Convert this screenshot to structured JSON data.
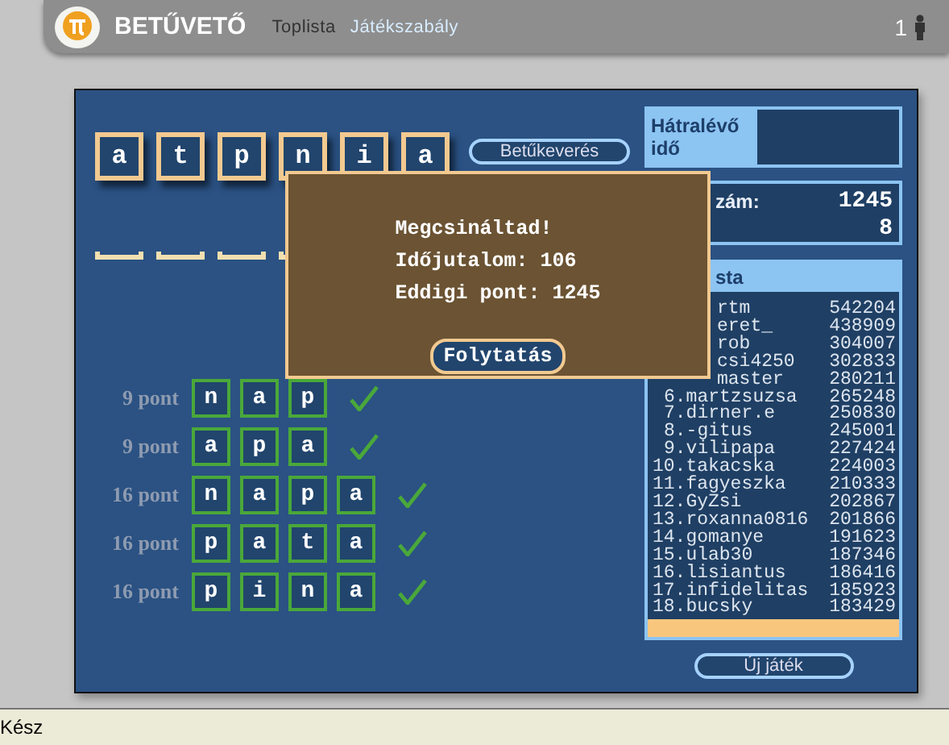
{
  "header": {
    "title": "BETŰVETŐ",
    "nav": [
      {
        "label": "Toplista",
        "selected": true
      },
      {
        "label": "Játékszabály",
        "selected": false
      }
    ],
    "online_count": "1"
  },
  "letters": [
    "a",
    "t",
    "p",
    "n",
    "i",
    "a"
  ],
  "shuffle_button": "Betűkeverés",
  "found_words": [
    {
      "points": "9 pont",
      "letters": [
        "n",
        "a",
        "p"
      ],
      "correct": true
    },
    {
      "points": "9 pont",
      "letters": [
        "a",
        "p",
        "a"
      ],
      "correct": true
    },
    {
      "points": "16 pont",
      "letters": [
        "n",
        "a",
        "p",
        "a"
      ],
      "correct": true
    },
    {
      "points": "16 pont",
      "letters": [
        "p",
        "a",
        "t",
        "a"
      ],
      "correct": true
    },
    {
      "points": "16 pont",
      "letters": [
        "p",
        "i",
        "n",
        "a"
      ],
      "correct": true
    }
  ],
  "dialog": {
    "lines": [
      "Megcsináltad!",
      "Időjutalom: 106",
      "Eddigi pont: 1245"
    ],
    "button": "Folytatás"
  },
  "time_box": {
    "label": "Hátralévő idő"
  },
  "score_box": {
    "rows": [
      {
        "label": "zám:",
        "value": "1245"
      },
      {
        "value": "8"
      }
    ]
  },
  "toplist": {
    "title": "sta",
    "rows": [
      {
        "name": "rtm",
        "score": "542204",
        "covered": true
      },
      {
        "name": "eret_",
        "score": "438909",
        "covered": true
      },
      {
        "name": "rob",
        "score": "304007",
        "covered": true
      },
      {
        "name": "csi4250",
        "score": "302833",
        "covered": true
      },
      {
        "name": "master",
        "score": "280211",
        "covered": true
      },
      {
        "name": "6.martzsuzsa",
        "score": "265248",
        "covered": false
      },
      {
        "name": "7.dirner.e",
        "score": "250830",
        "covered": false
      },
      {
        "name": "8.-gitus",
        "score": "245001",
        "covered": false
      },
      {
        "name": "9.vilipapa",
        "score": "227424",
        "covered": false
      },
      {
        "name": "10.takacska",
        "score": "224003",
        "covered": false
      },
      {
        "name": "11.fagyeszka",
        "score": "210333",
        "covered": false
      },
      {
        "name": "12.GyZsi",
        "score": "202867",
        "covered": false
      },
      {
        "name": "13.roxanna0816",
        "score": "201866",
        "covered": false
      },
      {
        "name": "14.gomanye",
        "score": "191623",
        "covered": false
      },
      {
        "name": "15.ulab30",
        "score": "187346",
        "covered": false
      },
      {
        "name": "16.lisiantus",
        "score": "186416",
        "covered": false
      },
      {
        "name": "17.infidelitas",
        "score": "185923",
        "covered": false
      },
      {
        "name": "18.bucsky",
        "score": "183429",
        "covered": false
      }
    ]
  },
  "new_game_button": "Új játék",
  "status_bar": "Kész"
}
